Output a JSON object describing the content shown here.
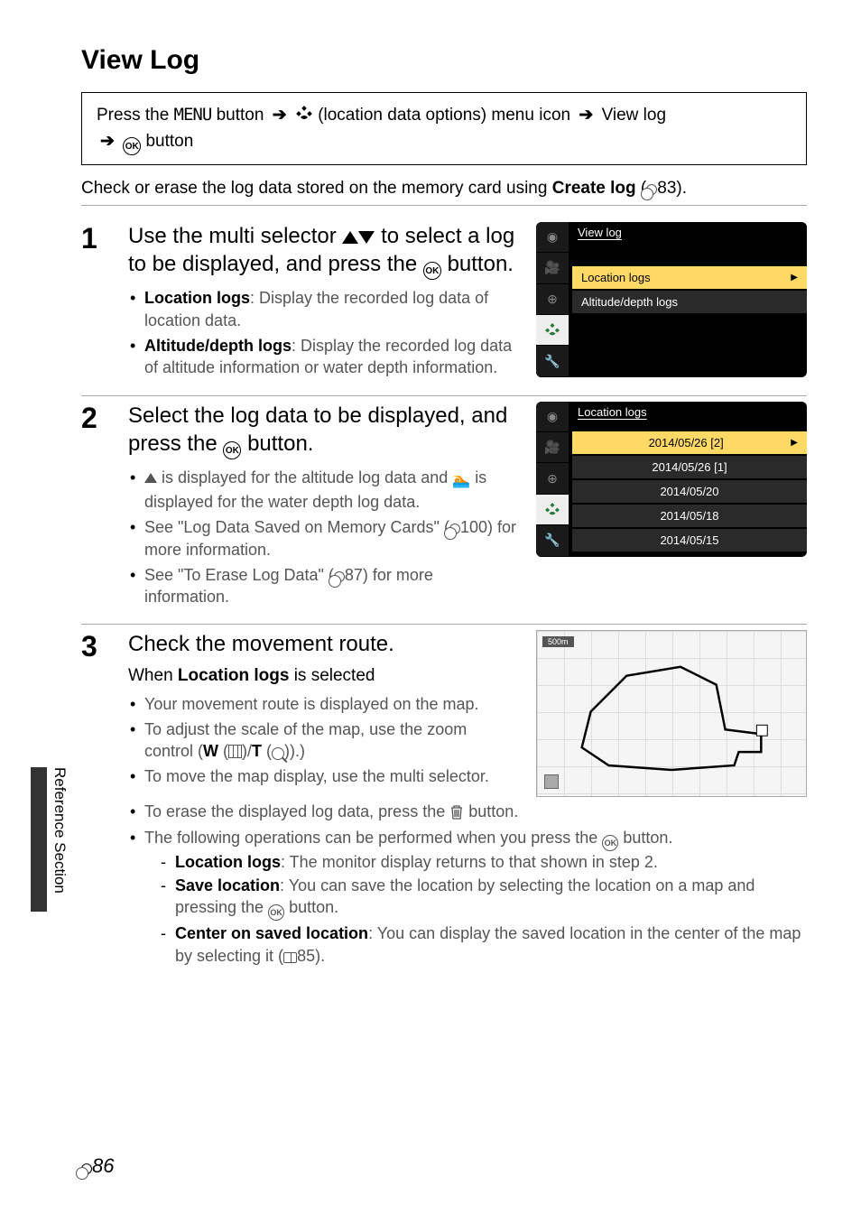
{
  "sidebar_label": "Reference Section",
  "page_title": "View Log",
  "nav": {
    "prefix": "Press the",
    "menu_btn": "MENU",
    "after_menu": "button",
    "loc_menu": "(location data options) menu icon",
    "view_log": "View log",
    "ok_btn": "button"
  },
  "intro": {
    "line": "Check or erase the log data stored on the memory card using",
    "bold": "Create log",
    "ref": "83)."
  },
  "step1": {
    "num": "1",
    "heading_a": "Use the multi selector",
    "heading_b": "to select a log to be displayed, and press the",
    "heading_c": "button.",
    "bullets": [
      {
        "bold": "Location logs",
        "rest": ": Display the recorded log data of location data."
      },
      {
        "bold": "Altitude/depth logs",
        "rest": ": Display the recorded log data of altitude information or water depth information."
      }
    ],
    "ui": {
      "title": "View log",
      "items": [
        "Location logs",
        "Altitude/depth logs"
      ]
    }
  },
  "step2": {
    "num": "2",
    "heading_a": "Select the log data to be displayed, and press the",
    "heading_b": "button.",
    "bullets": [
      {
        "text_a": "is displayed for the altitude log data and",
        "text_b": "is displayed for the water depth log data."
      },
      {
        "text": "See \"Log Data Saved on Memory Cards\" (",
        "ref": "100) for more information."
      },
      {
        "text": "See \"To Erase Log Data\" (",
        "ref": "87) for more information."
      }
    ],
    "ui": {
      "title": "Location logs",
      "items": [
        "2014/05/26 [2]",
        "2014/05/26 [1]",
        "2014/05/20",
        "2014/05/18",
        "2014/05/15"
      ]
    }
  },
  "step3": {
    "num": "3",
    "heading": "Check the movement route.",
    "sub": {
      "pre": "When ",
      "bold": "Location logs",
      "post": " is selected"
    },
    "bullets_top": [
      {
        "text": "Your movement route is displayed on the map."
      },
      {
        "text_a": "To adjust the scale of the map, use the zoom control (",
        "w": "W",
        "mid": "/",
        "t": "T",
        "tail": ")."
      },
      {
        "text": "To move the map display, use the multi selector."
      }
    ],
    "bullets_full": [
      {
        "text_a": "To erase the displayed log data, press the",
        "text_b": "button."
      },
      {
        "text_a": "The following operations can be performed when you press the",
        "text_b": "button."
      }
    ],
    "dashes": [
      {
        "bold": "Location logs",
        "rest": ": The monitor display returns to that shown in step 2."
      },
      {
        "bold": "Save location",
        "rest": ": You can save the location by selecting the location on a map and pressing the",
        "tail": "button."
      },
      {
        "bold": "Center on saved location",
        "rest": ":   You can display the saved location in the center of the map by selecting it (",
        "ref": "85)."
      }
    ],
    "map_scale": "500m"
  },
  "footer": "86"
}
